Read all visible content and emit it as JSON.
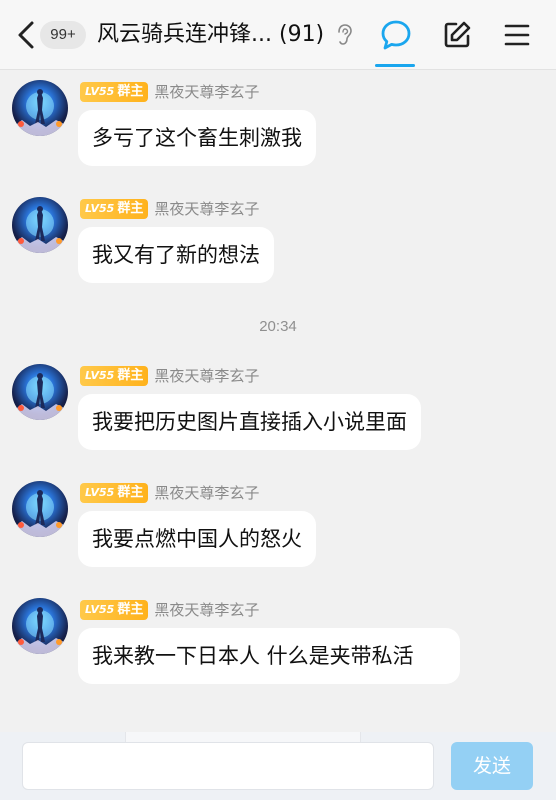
{
  "header": {
    "badge": "99+",
    "title": "风云骑兵连冲锋...",
    "member_count": "(91)"
  },
  "colors": {
    "accent": "#1aa6ee",
    "level_tag": "#ffb21c",
    "send_button": "#94d0f4",
    "background": "#f1f1f1"
  },
  "icons": {
    "back": "chevron-left-icon",
    "ear": "ear-icon",
    "chat": "chat-bubble-icon",
    "edit": "edit-icon",
    "menu": "menu-icon"
  },
  "messages": [
    {
      "level": "LV55",
      "role": "群主",
      "sender": "黑夜天尊李玄子",
      "text": "多亏了这个畜生刺激我"
    },
    {
      "level": "LV55",
      "role": "群主",
      "sender": "黑夜天尊李玄子",
      "text": "我又有了新的想法"
    },
    {
      "level": "LV55",
      "role": "群主",
      "sender": "黑夜天尊李玄子",
      "text": "我要把历史图片直接插入小说里面"
    },
    {
      "level": "LV55",
      "role": "群主",
      "sender": "黑夜天尊李玄子",
      "text": "我要点燃中国人的怒火"
    },
    {
      "level": "LV55",
      "role": "群主",
      "sender": "黑夜天尊李玄子",
      "text": "我来教一下日本人 什么是夹带私活"
    }
  ],
  "time_separator": "20:34",
  "input": {
    "value": "",
    "send_label": "发送"
  }
}
